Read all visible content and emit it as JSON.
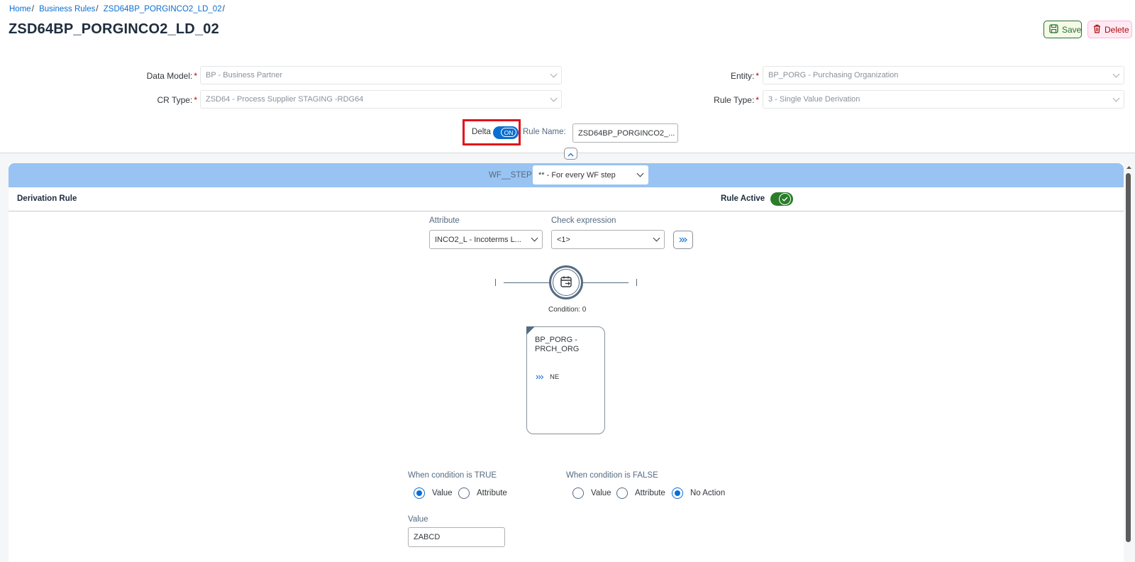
{
  "breadcrumb": {
    "items": [
      "Home",
      "Business Rules",
      "ZSD64BP_PORGINCO2_LD_02"
    ],
    "separator": "/"
  },
  "page": {
    "title": "ZSD64BP_PORGINCO2_LD_02"
  },
  "actions": {
    "save_label": "Save",
    "delete_label": "Delete"
  },
  "form": {
    "data_model": {
      "label": "Data Model:",
      "value": "BP - Business Partner"
    },
    "entity": {
      "label": "Entity:",
      "value": "BP_PORG - Purchasing Organization"
    },
    "cr_type": {
      "label": "CR Type:",
      "value": "ZSD64 - Process Supplier STAGING -RDG64"
    },
    "rule_type": {
      "label": "Rule Type:",
      "value": "3 - Single Value Derivation"
    },
    "required_marker": "*",
    "delta": {
      "label": "Delta",
      "toggle_text": "ON"
    },
    "rule_name": {
      "label": "Rule Name:",
      "value": "ZSD64BP_PORGINCO2_..."
    }
  },
  "workflow": {
    "label": "WF__STEP:",
    "value": "** - For every WF step"
  },
  "derivation": {
    "title": "Derivation Rule",
    "rule_active_label": "Rule Active",
    "attribute": {
      "label": "Attribute",
      "value": "INCO2_L - Incoterms L..."
    },
    "check_expression": {
      "label": "Check expression",
      "value": "<1>"
    },
    "condition_label": "Condition: 0",
    "card": {
      "title": "BP_PORG - PRCH_ORG",
      "operator": "NE"
    }
  },
  "condition_true": {
    "label": "When condition is TRUE",
    "options": [
      "Value",
      "Attribute"
    ],
    "selected": "Value"
  },
  "condition_false": {
    "label": "When condition is FALSE",
    "options": [
      "Value",
      "Attribute",
      "No Action"
    ],
    "selected": "No Action"
  },
  "value_field": {
    "label": "Value",
    "value": "ZABCD"
  },
  "colors": {
    "accent": "#0a6ed1",
    "wf_bar": "#99c3f2",
    "save_border": "#256f3a",
    "delete_text": "#aa0808",
    "rule_active": "#2b7d2b",
    "highlight_box": "#e0131b"
  }
}
